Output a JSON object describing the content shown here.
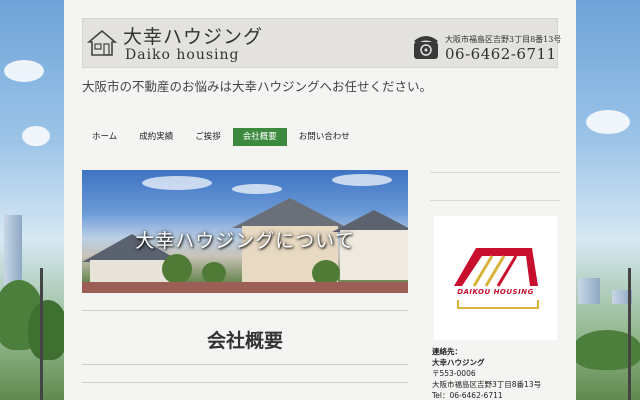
{
  "header": {
    "brand_jp": "大幸ハウジング",
    "brand_en": "Daiko  housing",
    "address": "大阪市福島区吉野3丁目8番13号",
    "phone": "06-6462-6711",
    "home_icon": "house-icon",
    "phone_icon": "telephone-icon"
  },
  "tagline": "大阪市の不動産のお悩みは大幸ハウジングへお任せください。",
  "nav": {
    "items": [
      {
        "label": "ホーム"
      },
      {
        "label": "成約実績"
      },
      {
        "label": "ご挨拶"
      },
      {
        "label": "会社概要"
      },
      {
        "label": "お問い合わせ"
      }
    ],
    "active": "会社概要"
  },
  "hero": {
    "title": "大幸ハウジングについて"
  },
  "main": {
    "section_title": "会社概要"
  },
  "sidebar": {
    "logo_text": "DAIKOU HOUSING",
    "contact_label": "連絡先：",
    "company": "大幸ハウジング",
    "postal": "〒553-0006",
    "address": "大阪市福島区吉野3丁目8番13号",
    "tel": "Tel：06-6462-6711"
  },
  "colors": {
    "nav_active": "#3b8a3e",
    "logo_red": "#c8102e",
    "logo_gold": "#d8b23a"
  }
}
